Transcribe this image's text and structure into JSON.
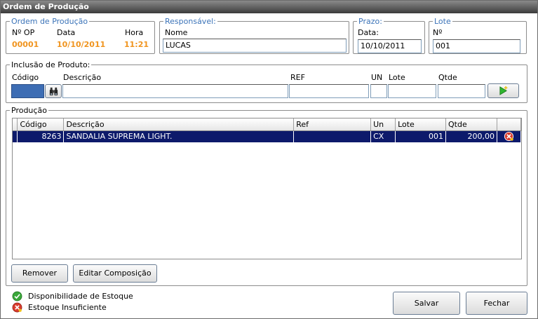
{
  "window": {
    "title": "Ordem de Produção"
  },
  "ordem": {
    "legend": "Ordem de Produção",
    "op_label": "Nº OP",
    "op_value": "00001",
    "data_label": "Data",
    "data_value": "10/10/2011",
    "hora_label": "Hora",
    "hora_value": "11:21"
  },
  "responsavel": {
    "legend": "Responsável:",
    "nome_label": "Nome",
    "nome_value": "LUCAS"
  },
  "prazo": {
    "legend": "Prazo:",
    "data_label": "Data:",
    "data_value": "10/10/2011"
  },
  "lote": {
    "legend": "Lote",
    "no_label": "Nº",
    "no_value": "001"
  },
  "inclusao": {
    "legend": "Inclusão de Produto:",
    "codigo_label": "Código",
    "descricao_label": "Descrição",
    "ref_label": "REF",
    "un_label": "UN",
    "lote_label": "Lote",
    "qtde_label": "Qtde",
    "codigo_value": "",
    "descricao_value": "",
    "ref_value": "",
    "un_value": "",
    "lote_value": "",
    "qtde_value": ""
  },
  "producao": {
    "legend": "Produção",
    "columns": [
      "Código",
      "Descrição",
      "Ref",
      "Un",
      "Lote",
      "Qtde"
    ],
    "rows": [
      {
        "codigo": "8263",
        "descricao": "SANDALIA SUPREMA LIGHT.",
        "ref": "",
        "un": "CX",
        "lote": "001",
        "qtde": "200,00",
        "status_icon": "error-icon"
      }
    ],
    "remover_label": "Remover",
    "editar_label": "Editar Composição"
  },
  "legenda": {
    "disponivel": "Disponibilidade de Estoque",
    "insuficiente": "Estoque Insuficiente"
  },
  "buttons": {
    "salvar": "Salvar",
    "fechar": "Fechar"
  },
  "colors": {
    "accent_orange": "#f0941e",
    "legend_blue": "#3b73b8",
    "row_selected": "#0d1a6b"
  }
}
